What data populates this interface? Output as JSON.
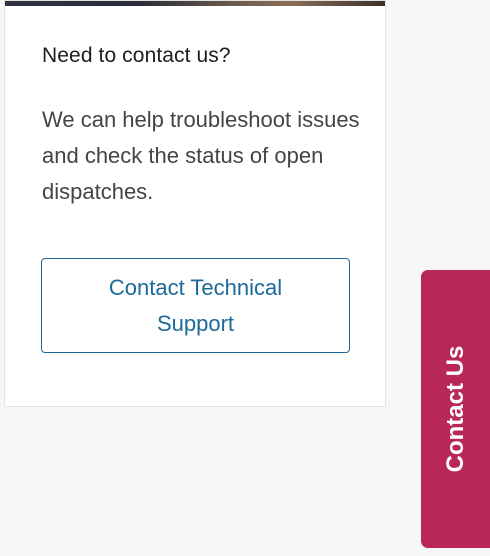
{
  "card": {
    "title": "Need to contact us?",
    "description": "We can help troubleshoot issues and check the status of open dispatches.",
    "button_label": "Contact Technical Support"
  },
  "contact_tab": {
    "label": "Contact Us"
  },
  "colors": {
    "accent_blue": "#1b6a98",
    "tab_magenta": "#b8275a",
    "page_background": "#f7f7f7"
  }
}
